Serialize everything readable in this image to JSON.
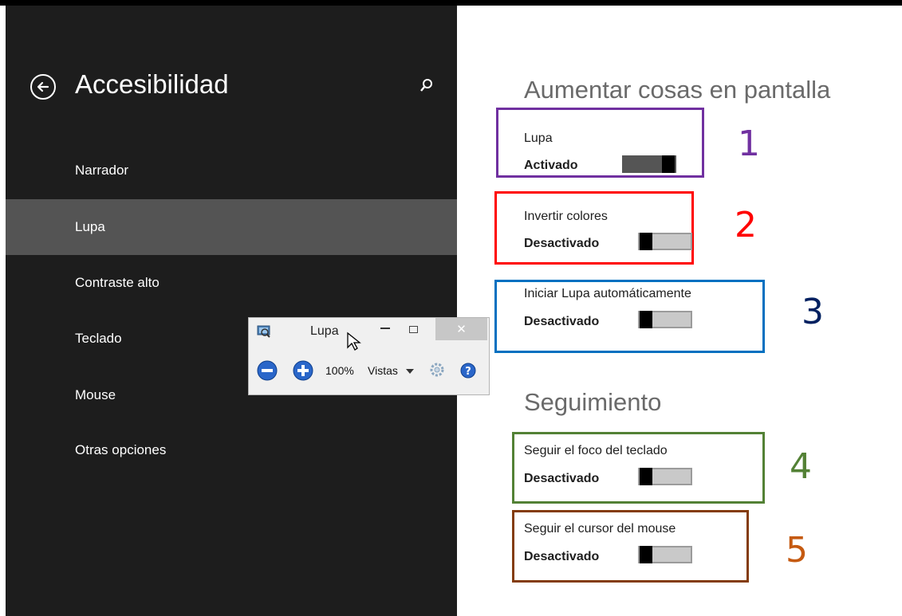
{
  "sidebar": {
    "title": "Accesibilidad",
    "items": [
      {
        "label": "Narrador",
        "selected": false
      },
      {
        "label": "Lupa",
        "selected": true
      },
      {
        "label": "Contraste alto",
        "selected": false
      },
      {
        "label": "Teclado",
        "selected": false
      },
      {
        "label": "Mouse",
        "selected": false
      },
      {
        "label": "Otras opciones",
        "selected": false
      }
    ]
  },
  "main": {
    "section1_heading": "Aumentar cosas en pantalla",
    "section2_heading": "Seguimiento",
    "settings": [
      {
        "label": "Lupa",
        "state": "Activado",
        "on": true,
        "marker": "1",
        "marker_color": "#7030a0"
      },
      {
        "label": "Invertir colores",
        "state": "Desactivado",
        "on": false,
        "marker": "2",
        "marker_color": "#ff0000"
      },
      {
        "label": "Iniciar Lupa automáticamente",
        "state": "Desactivado",
        "on": false,
        "marker": "3",
        "marker_color": "#002060"
      },
      {
        "label": "Seguir el foco del teclado",
        "state": "Desactivado",
        "on": false,
        "marker": "4",
        "marker_color": "#538135"
      },
      {
        "label": "Seguir el cursor del mouse",
        "state": "Desactivado",
        "on": false,
        "marker": "5",
        "marker_color": "#c55a11"
      }
    ]
  },
  "magnifier_window": {
    "title": "Lupa",
    "zoom": "100%",
    "views_label": "Vistas",
    "icons": [
      "magnifier-app-icon",
      "zoom-out-icon",
      "zoom-in-icon",
      "settings-gear-icon",
      "help-icon"
    ]
  },
  "colors": {
    "sidebar_bg": "#1d1d1d",
    "selected_item_bg": "#545454",
    "box_1": "#7030a0",
    "box_2": "#ff0000",
    "box_3": "#0070c0",
    "box_4": "#538135",
    "box_5": "#843c0c"
  }
}
